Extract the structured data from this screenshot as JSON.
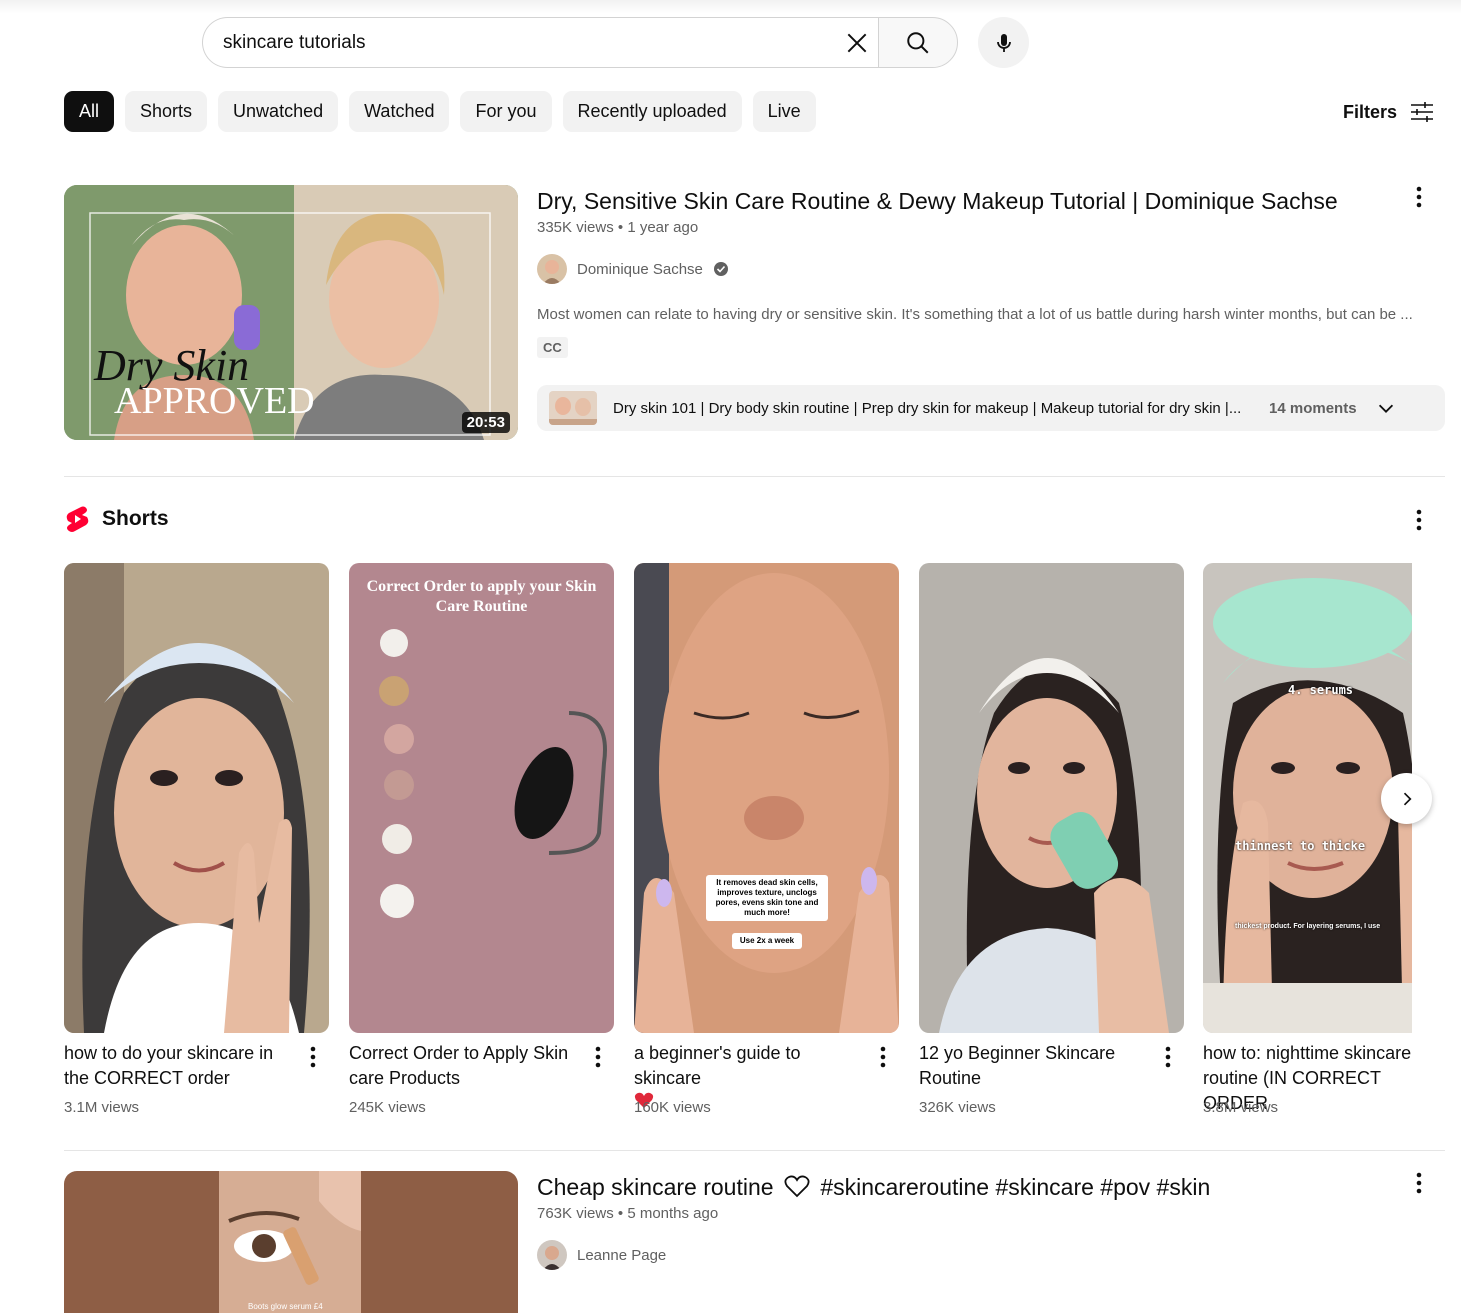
{
  "search": {
    "query": "skincare tutorials"
  },
  "chips": [
    "All",
    "Shorts",
    "Unwatched",
    "Watched",
    "For you",
    "Recently uploaded",
    "Live"
  ],
  "filters_label": "Filters",
  "video1": {
    "title": "Dry, Sensitive Skin Care Routine & Dewy Makeup Tutorial | Dominique Sachse",
    "views": "335K views",
    "age": "1 year ago",
    "channel": "Dominique Sachse",
    "description": "Most women can relate to having dry or sensitive skin. It's something that a lot of us battle during harsh winter months, but can be ...",
    "cc": "CC",
    "duration": "20:53",
    "thumb_text_1": "Dry Skin",
    "thumb_text_2": "APPROVED",
    "moments_text": "Dry skin 101 | Dry body skin routine | Prep dry skin for makeup | Makeup tutorial for dry skin |...",
    "moments_count": "14 moments"
  },
  "shorts_shelf": {
    "title": "Shorts",
    "items": [
      {
        "title": "how to do your skincare in the CORRECT order",
        "views": "3.1M views"
      },
      {
        "title": "Correct Order to Apply Skin care Products",
        "views": "245K views",
        "overlay": "Correct Order to apply your Skin Care Routine"
      },
      {
        "title": "a beginner's guide to skincare",
        "views": "160K views",
        "caption": "It removes dead skin cells, improves texture, unclogs pores, evens skin tone and much more!",
        "caption2": "Use 2x a week"
      },
      {
        "title": "12 yo Beginner Skincare Routine",
        "views": "326K views"
      },
      {
        "title": "how to: nighttime skincare routine (IN CORRECT ORDER",
        "views": "3.8M views",
        "overlay": "4. serums",
        "overlay2": "thinnest to thicke",
        "overlay3": "thickest product. For layering serums, I use"
      }
    ]
  },
  "video2": {
    "title": "Cheap skincare routine",
    "tags": "#skincareroutine #skincare #pov #skin",
    "views": "763K views",
    "age": "5 months ago",
    "channel": "Leanne Page",
    "thumb_caption": "Boots glow serum £4"
  },
  "colors": {
    "accent_red": "#ff0033",
    "chip_bg": "#f2f2f2",
    "text_secondary": "#606060"
  }
}
